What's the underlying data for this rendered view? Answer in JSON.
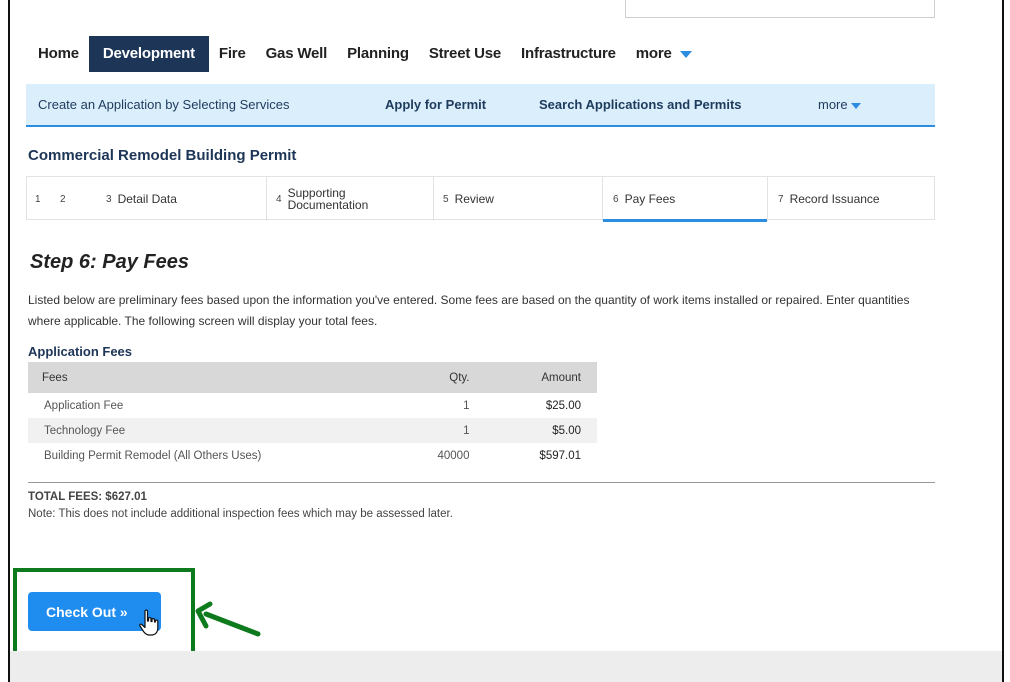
{
  "main_nav": {
    "items": [
      {
        "label": "Home",
        "active": false
      },
      {
        "label": "Development",
        "active": true
      },
      {
        "label": "Fire",
        "active": false
      },
      {
        "label": "Gas Well",
        "active": false
      },
      {
        "label": "Planning",
        "active": false
      },
      {
        "label": "Street Use",
        "active": false
      },
      {
        "label": "Infrastructure",
        "active": false
      }
    ],
    "more_label": "more"
  },
  "sub_nav": {
    "create": "Create an Application by Selecting Services",
    "apply": "Apply for Permit",
    "search": "Search Applications and Permits",
    "more": "more"
  },
  "permit_title": "Commercial Remodel Building Permit",
  "steps": [
    {
      "num": "1",
      "label": ""
    },
    {
      "num": "2",
      "label": ""
    },
    {
      "num": "3",
      "label": "Detail Data"
    },
    {
      "num": "4",
      "label": "Supporting Documentation",
      "label_line1": "Supporting",
      "label_line2": "Documentation"
    },
    {
      "num": "5",
      "label": "Review"
    },
    {
      "num": "6",
      "label": "Pay Fees",
      "active": true
    },
    {
      "num": "7",
      "label": "Record Issuance"
    }
  ],
  "step_heading": "Step 6: Pay Fees",
  "intro_text": "Listed below are preliminary fees based upon the information you've entered. Some fees are based on the quantity of work items installed or repaired. Enter quantities where applicable. The following screen will display your total fees.",
  "fees": {
    "title": "Application Fees",
    "headers": {
      "fees": "Fees",
      "qty": "Qty.",
      "amount": "Amount"
    },
    "rows": [
      {
        "name": "Application Fee",
        "qty": "1",
        "amount": "$25.00"
      },
      {
        "name": "Technology Fee",
        "qty": "1",
        "amount": "$5.00"
      },
      {
        "name": "Building Permit Remodel (All Others Uses)",
        "qty": "40000",
        "amount": "$597.01"
      }
    ]
  },
  "total_fees": "TOTAL FEES: $627.01",
  "note": "Note: This does not include additional inspection fees which may be assessed later.",
  "checkout_label": "Check Out »",
  "colors": {
    "nav_active": "#1d3557",
    "accent_blue": "#2a8de0",
    "button_blue": "#1f8cf0",
    "highlight_green": "#0e7a1e",
    "subnav_bg": "#dbeefb"
  }
}
